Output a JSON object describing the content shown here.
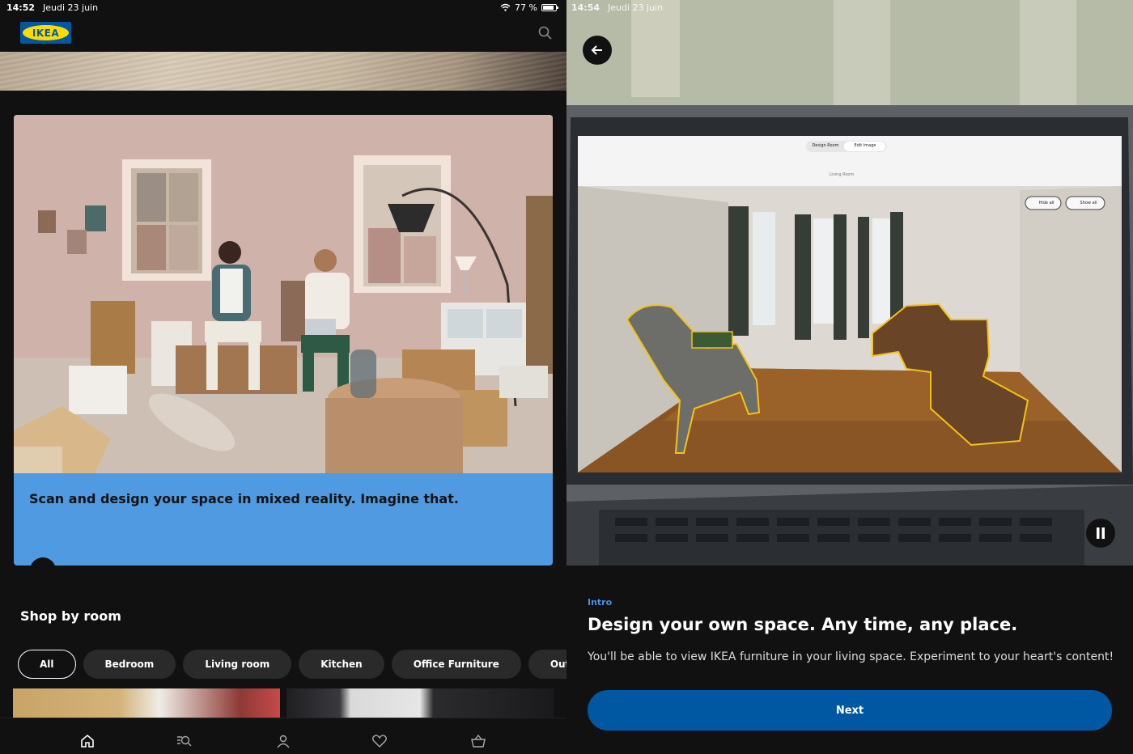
{
  "left": {
    "status": {
      "time": "14:52",
      "date": "Jeudi 23 juin",
      "battery": "77 %"
    },
    "brand": {
      "logo_text": "IKEA"
    },
    "promo": {
      "text": "Scan and design your space in mixed reality. Imagine that.",
      "text_background": "#4f9ae0"
    },
    "shop_by_room": {
      "title": "Shop by room",
      "chips": [
        "All",
        "Bedroom",
        "Living room",
        "Kitchen",
        "Office Furniture",
        "Outdoor"
      ],
      "selected": "All"
    },
    "tabbar": [
      "home-icon",
      "search-list-icon",
      "profile-icon",
      "heart-icon",
      "basket-icon"
    ]
  },
  "right": {
    "status": {
      "time": "14:54",
      "date": "Jeudi 23 juin"
    },
    "video_screen": {
      "tabs": [
        "Design Room",
        "Edit Image"
      ],
      "room_label": "Living Room",
      "buttons": [
        "Hide all",
        "Show all"
      ]
    },
    "intro": {
      "label": "Intro",
      "title": "Design your own space. Any time, any place.",
      "description": "You'll be able to view IKEA furniture in your living space. Experiment to your heart's content!",
      "next_label": "Next"
    },
    "colors": {
      "accent": "#0058a3",
      "intro_label": "#4b8fe0",
      "highlight": "#f2c21b"
    }
  }
}
